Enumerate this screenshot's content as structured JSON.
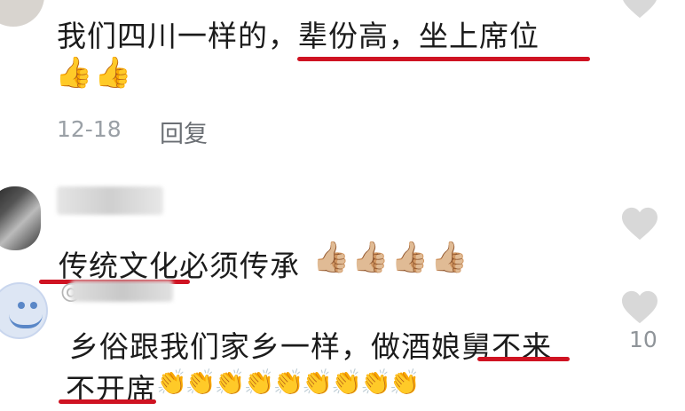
{
  "comments": [
    {
      "text": "我们四川一样的，辈份高，坐上席位",
      "emoji": "👍👍",
      "date": "12-18",
      "reply_label": "回复"
    },
    {
      "text": "传统文化必须传承",
      "emoji": "👍🏼👍🏼👍🏼👍🏼"
    },
    {
      "reply_to_prefix": "@",
      "text_line1": "乡俗跟我们家乡一样，做酒娘舅不来",
      "text_line2": "不开席",
      "emoji": "👏👏👏👏👏👏👏👏👏",
      "like_count": "10"
    }
  ],
  "colors": {
    "underline": "#cf1322",
    "heart": "#d8d8d8",
    "meta": "#9aa0a6"
  },
  "icons": [
    "heart-icon",
    "thumbs-up-emoji",
    "clap-emoji"
  ]
}
